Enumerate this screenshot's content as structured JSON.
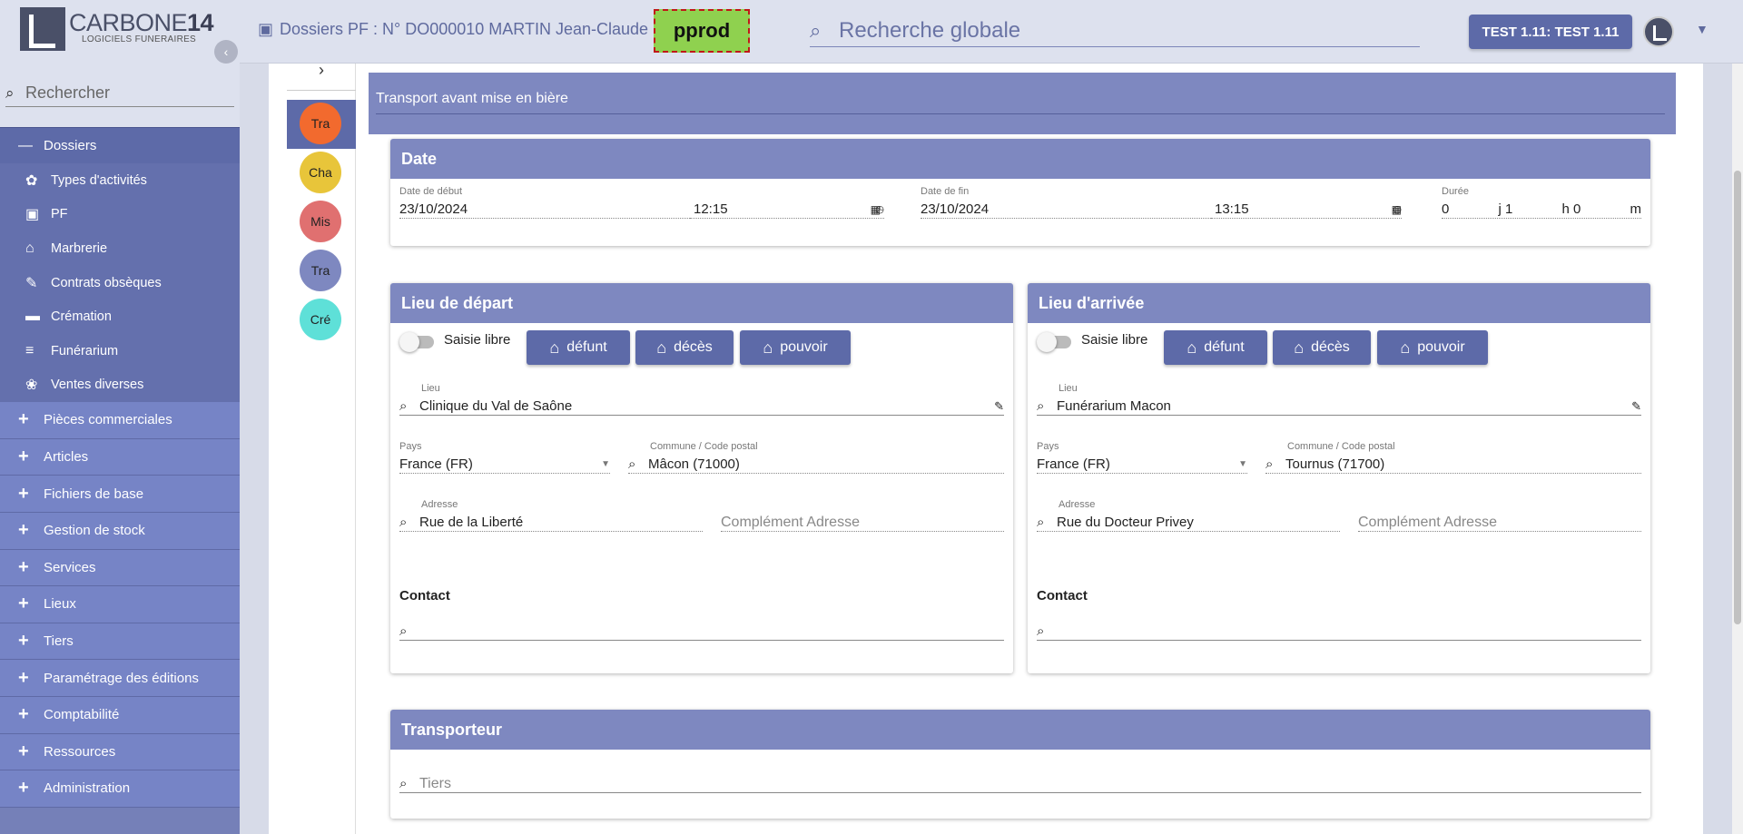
{
  "app": {
    "brand_main": "CARBONE",
    "brand_num": "14",
    "brand_sub": "LOGICIELS FUNERAIRES"
  },
  "sidebar": {
    "search_placeholder": "Rechercher",
    "group": {
      "label": "Dossiers",
      "symbol": "—"
    },
    "sub_items": [
      {
        "label": "Types d'activités",
        "icon": "activities-icon"
      },
      {
        "label": "PF",
        "icon": "person-card-icon"
      },
      {
        "label": "Marbrerie",
        "icon": "marble-icon"
      },
      {
        "label": "Contrats obsèques",
        "icon": "contract-icon"
      },
      {
        "label": "Crémation",
        "icon": "cremation-icon"
      },
      {
        "label": "Funérarium",
        "icon": "bed-icon"
      },
      {
        "label": "Ventes diverses",
        "icon": "flower-icon"
      }
    ],
    "items": [
      "Pièces commerciales",
      "Articles",
      "Fichiers de base",
      "Gestion de stock",
      "Services",
      "Lieux",
      "Tiers",
      "Paramétrage des éditions",
      "Comptabilité",
      "Ressources",
      "Administration"
    ]
  },
  "topbar": {
    "breadcrumb": "Dossiers PF : N° DO000010 MARTIN Jean-Claude",
    "env": "pprod",
    "search_placeholder": "Recherche globale",
    "user_button": "TEST 1.11: TEST 1.11"
  },
  "steps": [
    {
      "label": "Tra",
      "color": "#f26a2e"
    },
    {
      "label": "Cha",
      "color": "#e8c53a"
    },
    {
      "label": "Mis",
      "color": "#e07070"
    },
    {
      "label": "Tra",
      "color": "#7e88c0"
    },
    {
      "label": "Cré",
      "color": "#5ee0d8"
    }
  ],
  "panel": {
    "title": "Transport avant mise en bière"
  },
  "date_card": {
    "title": "Date",
    "start_label": "Date de début",
    "start_date": "23/10/2024",
    "start_time": "12:15",
    "end_label": "Date de fin",
    "end_date": "23/10/2024",
    "end_time": "13:15",
    "duration_label": "Durée",
    "d_value": "0",
    "d_unit": "j",
    "h_value": "1",
    "h_unit": "h",
    "m_value": "0",
    "m_unit": "m"
  },
  "departure": {
    "title": "Lieu de départ",
    "toggle_label": "Saisie libre",
    "buttons": [
      "défunt",
      "décès",
      "pouvoir"
    ],
    "lieu_label": "Lieu",
    "lieu": "Clinique du Val de Saône",
    "pays_label": "Pays",
    "pays": "France (FR)",
    "commune_label": "Commune / Code postal",
    "commune": "Mâcon (71000)",
    "adresse_label": "Adresse",
    "adresse": "Rue de la Liberté",
    "complement_placeholder": "Complément Adresse",
    "contact_label": "Contact"
  },
  "arrival": {
    "title": "Lieu d'arrivée",
    "toggle_label": "Saisie libre",
    "buttons": [
      "défunt",
      "décès",
      "pouvoir"
    ],
    "lieu_label": "Lieu",
    "lieu": "Funérarium Macon",
    "pays_label": "Pays",
    "pays": "France (FR)",
    "commune_label": "Commune / Code postal",
    "commune": "Tournus (71700)",
    "adresse_label": "Adresse",
    "adresse": "Rue du Docteur Privey",
    "complement_placeholder": "Complément Adresse",
    "contact_label": "Contact"
  },
  "transporter": {
    "title": "Transporteur",
    "placeholder": "Tiers"
  },
  "colors": {
    "primary": "#5d6aa8",
    "header": "#7e88c0",
    "env_bg": "#8fd14f",
    "env_border": "#c01818"
  }
}
